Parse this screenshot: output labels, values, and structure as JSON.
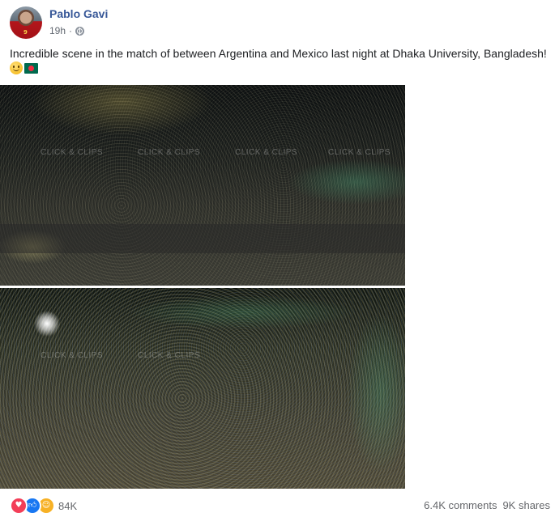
{
  "post": {
    "author": "Pablo Gavi",
    "time": "19h",
    "separator": "·",
    "privacy_icon": "globe-icon",
    "text": "Incredible scene in the match of between Argentina and Mexico last night at Dhaka University, Bangladesh!",
    "emojis": [
      "smiling-face-icon",
      "bangladesh-flag-icon"
    ],
    "avatar_number": "9"
  },
  "photos": [
    {
      "watermark": "CLICK & CLIPS"
    },
    {
      "watermark": "CLICK & CLIPS"
    }
  ],
  "footer": {
    "reaction_icons": [
      "love-icon",
      "like-icon",
      "care-icon"
    ],
    "reaction_count": "84K",
    "comments": "6.4K comments",
    "shares": "9K shares"
  },
  "colors": {
    "author_link": "#385898",
    "meta_gray": "#616770",
    "like_blue": "#1877f2",
    "love_red": "#f33e58",
    "care_yellow": "#f7b125"
  }
}
